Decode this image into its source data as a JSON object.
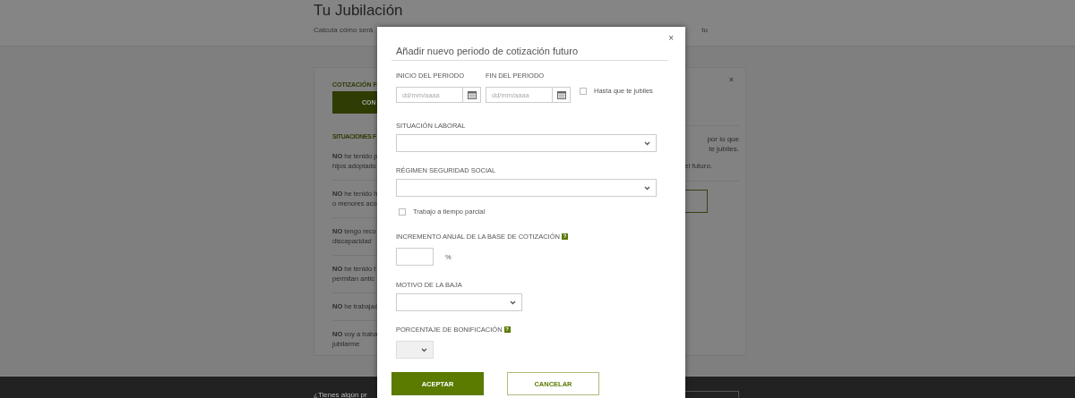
{
  "page": {
    "title": "Tu Jubilación",
    "subtitle_parts": [
      "Calcula cómo será",
      "tu"
    ]
  },
  "card": {
    "left": {
      "section_label": "COTIZACIÓN F",
      "button": "CON",
      "situations_label": "SITUACIONES F",
      "situations": [
        {
          "text": "**NO** he tenido p\nhijos adoptado"
        },
        {
          "text": "**NO** he tenido h\no menores aco"
        },
        {
          "text": "**NO** tengo reco\ndiscapacidad"
        },
        {
          "text": "**NO** he tenido t\npermitan antic"
        },
        {
          "text": "**NO** he trabajad"
        },
        {
          "text": "**NO** voy a traba\njubilarme"
        }
      ]
    },
    "right": {
      "close": "×",
      "lines": [
        "por lo que",
        "te jubiles.",
        "el futuro."
      ]
    }
  },
  "footer": {
    "text": "¿Tienes algún pr"
  },
  "modal": {
    "close": "×",
    "title": "Añadir nuevo periodo de cotización futuro",
    "start": {
      "label": "INICIO DEL PERIODO",
      "placeholder": "dd/mm/aaaa"
    },
    "end": {
      "label": "FIN DEL PERIODO",
      "placeholder": "dd/mm/aaaa"
    },
    "until_retirement": {
      "label": "Hasta que te jubiles",
      "checked": false
    },
    "employment": {
      "label": "SITUACIÓN LABORAL"
    },
    "regime": {
      "label": "RÉGIMEN SEGURIDAD SOCIAL"
    },
    "part_time": {
      "label": "Trabajo a tiempo parcial",
      "checked": false
    },
    "increment": {
      "label": "INCREMENTO ANUAL DE LA BASE DE COTIZACIÓN",
      "help": "?",
      "unit": "%"
    },
    "leave_reason": {
      "label": "MOTIVO DE LA BAJA"
    },
    "bonus": {
      "label": "PORCENTAJE DE BONIFICACIÓN",
      "help": "?",
      "disabled": true
    },
    "buttons": [
      {
        "label": "ACEPTAR",
        "kind": "primary"
      },
      {
        "label": "CANCELAR",
        "kind": "secondary"
      }
    ]
  }
}
